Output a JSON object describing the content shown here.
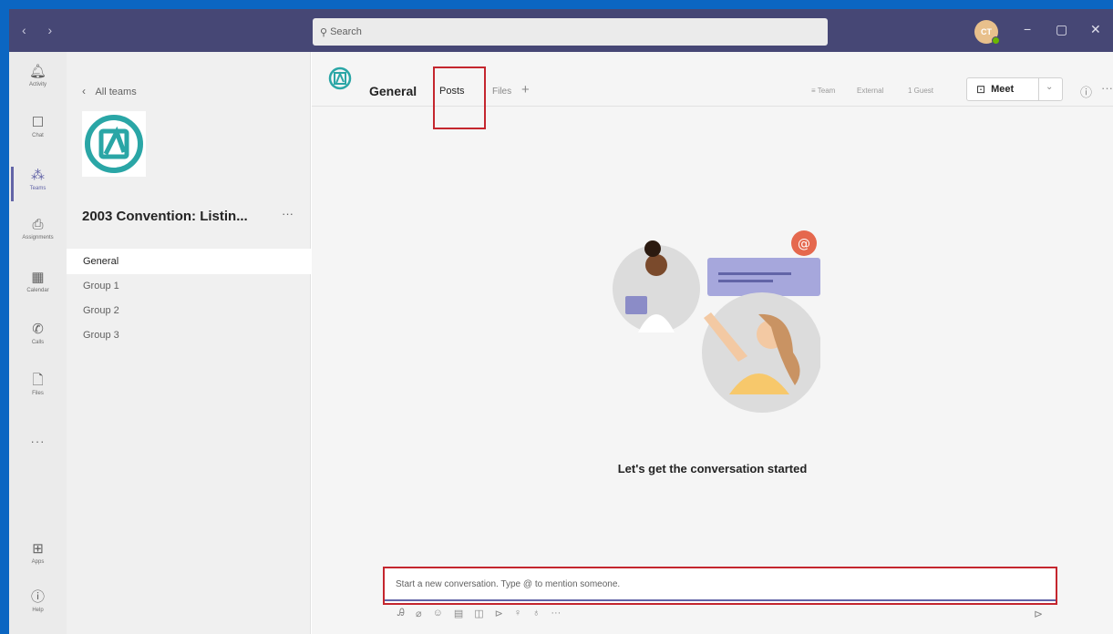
{
  "search": {
    "placeholder": "Search"
  },
  "user": {
    "initials": "CT"
  },
  "window": {
    "minimize": "−",
    "maximize": "▢",
    "close": "✕"
  },
  "nav": {
    "arrows": "‹ ›"
  },
  "rail": {
    "items": [
      {
        "label": "Activity",
        "icon": "bell-icon",
        "glyph": "🔔"
      },
      {
        "label": "Chat",
        "icon": "chat-icon",
        "glyph": "💬"
      },
      {
        "label": "Teams",
        "icon": "teams-icon",
        "glyph": "👥"
      },
      {
        "label": "Assignments",
        "icon": "assignments-icon",
        "glyph": "📋"
      },
      {
        "label": "Calendar",
        "icon": "calendar-icon",
        "glyph": "📅"
      },
      {
        "label": "Calls",
        "icon": "phone-icon",
        "glyph": "📞"
      },
      {
        "label": "Files",
        "icon": "file-icon",
        "glyph": "📄"
      }
    ],
    "more": "···",
    "bottom": [
      {
        "label": "Apps",
        "icon": "apps-icon",
        "glyph": "⊞"
      },
      {
        "label": "Help",
        "icon": "help-icon",
        "glyph": "?"
      }
    ]
  },
  "team": {
    "back_label": "All teams",
    "name": "2003 Convention: Listin...",
    "more": "···",
    "channels": [
      "General",
      "Group 1",
      "Group 2",
      "Group 3"
    ]
  },
  "channel": {
    "name": "General",
    "tabs": {
      "posts": "Posts",
      "files": "Files",
      "add": "+"
    },
    "chips": {
      "team": "Team",
      "external": "External",
      "guest": "1 Guest"
    },
    "meet_label": "Meet"
  },
  "main": {
    "empty_title": "Let's get the conversation started"
  },
  "compose": {
    "placeholder": "Start a new conversation. Type @ to mention someone."
  },
  "colors": {
    "frame": "#0b66c2",
    "topbar": "#464775",
    "accent": "#6264a7",
    "highlight": "#c4262e",
    "teal": "#2aa6a6"
  }
}
